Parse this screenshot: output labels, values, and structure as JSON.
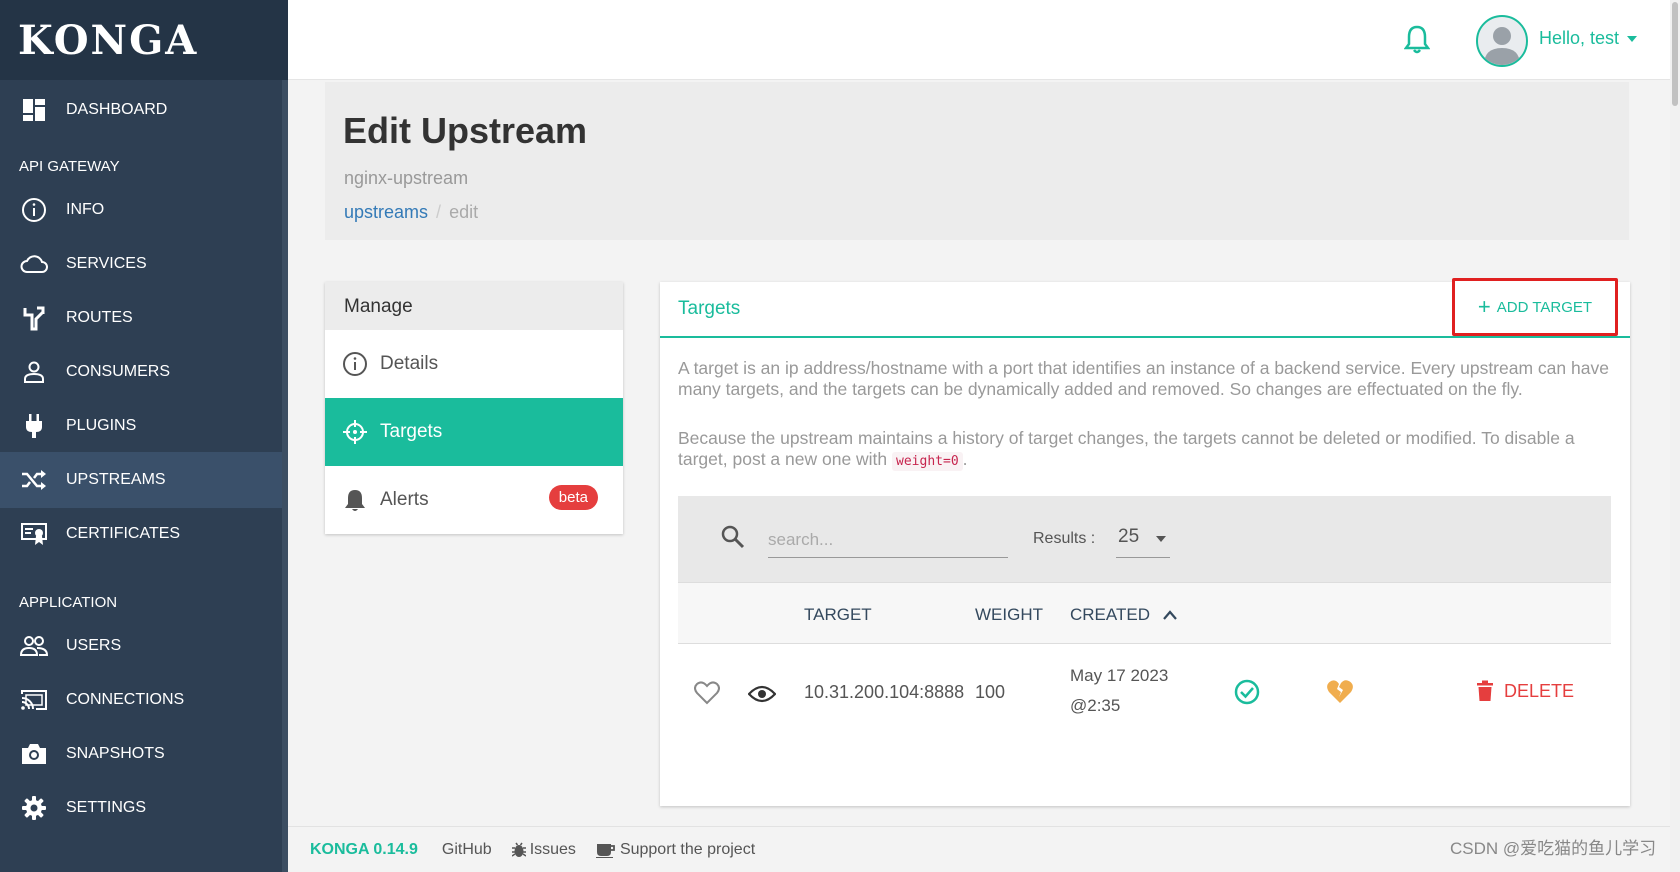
{
  "app": {
    "logo": "KONGA"
  },
  "sidebar": {
    "items": [
      {
        "label": "DASHBOARD",
        "icon": "dashboard-icon"
      },
      {
        "label": "INFO",
        "icon": "info-icon"
      },
      {
        "label": "SERVICES",
        "icon": "cloud-icon"
      },
      {
        "label": "ROUTES",
        "icon": "routes-icon"
      },
      {
        "label": "CONSUMERS",
        "icon": "user-icon"
      },
      {
        "label": "PLUGINS",
        "icon": "plug-icon"
      },
      {
        "label": "UPSTREAMS",
        "icon": "shuffle-icon"
      },
      {
        "label": "CERTIFICATES",
        "icon": "certificate-icon"
      },
      {
        "label": "USERS",
        "icon": "users-icon"
      },
      {
        "label": "CONNECTIONS",
        "icon": "cast-icon"
      },
      {
        "label": "SNAPSHOTS",
        "icon": "camera-icon"
      },
      {
        "label": "SETTINGS",
        "icon": "gear-icon"
      }
    ],
    "sections": {
      "api_gateway": "API GATEWAY",
      "application": "APPLICATION"
    },
    "active": "UPSTREAMS"
  },
  "topbar": {
    "greeting": "Hello, test"
  },
  "page": {
    "title": "Edit Upstream",
    "subtitle": "nginx-upstream",
    "breadcrumb": {
      "link": "upstreams",
      "separator": "/",
      "current": "edit"
    }
  },
  "manage": {
    "title": "Manage",
    "items": [
      {
        "label": "Details"
      },
      {
        "label": "Targets"
      },
      {
        "label": "Alerts",
        "badge": "beta"
      }
    ],
    "active": "Targets"
  },
  "targets": {
    "title": "Targets",
    "add_button": "ADD TARGET",
    "description_1": "A target is an ip address/hostname with a port that identifies an instance of a backend service. Every upstream can have many targets, and the targets can be dynamically added and removed. So changes are effectuated on the fly.",
    "description_2_prefix": "Because the upstream maintains a history of target changes, the targets cannot be deleted or modified. To disable a target, post a new one with ",
    "description_2_code": "weight=0",
    "description_2_suffix": ".",
    "search_placeholder": "search...",
    "results_label": "Results :",
    "results_value": "25",
    "columns": [
      "TARGET",
      "WEIGHT",
      "CREATED"
    ],
    "rows": [
      {
        "target": "10.31.200.104:8888",
        "weight": "100",
        "created_date": "May 17 2023",
        "created_time": "@2:35",
        "action": "DELETE"
      }
    ]
  },
  "footer": {
    "version": "KONGA 0.14.9",
    "links": [
      "GitHub",
      "Issues",
      "Support the project"
    ]
  },
  "watermark": "CSDN @爱吃猫的鱼儿学习",
  "colors": {
    "accent": "#1abc9c",
    "sidebar": "#2e3f53",
    "danger": "#e53e3e",
    "highlight_box": "#e02020"
  }
}
